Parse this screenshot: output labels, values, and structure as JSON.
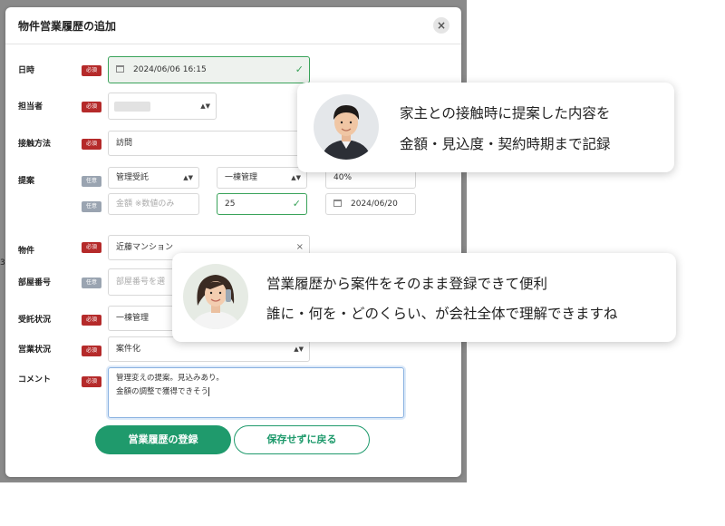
{
  "modal": {
    "title": "物件営業履歴の追加",
    "close_glyph": "×"
  },
  "badges": {
    "required": "必須",
    "optional": "任意"
  },
  "fields": {
    "datetime": {
      "label": "日時",
      "value": "2024/06/06 16:15"
    },
    "staff": {
      "label": "担当者"
    },
    "contact_method": {
      "label": "接触方法",
      "value": "訪問"
    },
    "proposal": {
      "label": "提案",
      "type_value": "管理受託",
      "management_value": "一棟管理",
      "percent_value": "40%",
      "amount_placeholder": "金額 ※数値のみ",
      "amount_value": "25",
      "date_value": "2024/06/20"
    },
    "property": {
      "label": "物件",
      "value": "近藤マンション",
      "clear_glyph": "×"
    },
    "room_number": {
      "label": "部屋番号",
      "placeholder": "部屋番号を選"
    },
    "consignment_status": {
      "label": "受託状況",
      "value": "一棟管理"
    },
    "sales_status": {
      "label": "営業状況",
      "value": "案件化"
    },
    "comment": {
      "label": "コメント",
      "lines": [
        "管理変えの提案。見込みあり。",
        "金額の調整で獲得できそう"
      ]
    }
  },
  "buttons": {
    "register": "営業履歴の登録",
    "back": "保存せずに戻る"
  },
  "testimonials": [
    {
      "lines": [
        "家主との接触時に提案した内容を",
        "金額・見込度・契約時期まで記録"
      ]
    },
    {
      "lines": [
        "営業履歴から案件をそのまま登録できて便利",
        "誰に・何を・どのくらい、が会社全体で理解できますね"
      ]
    }
  ],
  "edge_glyph": "3",
  "colors": {
    "accent": "#1f9a6c",
    "required_badge": "#b52a2a",
    "optional_badge": "#9aa4b1",
    "valid": "#3aa35a"
  },
  "icons": [
    "close-icon",
    "calendar-icon",
    "check-icon",
    "select-caret-icon",
    "clear-icon"
  ]
}
